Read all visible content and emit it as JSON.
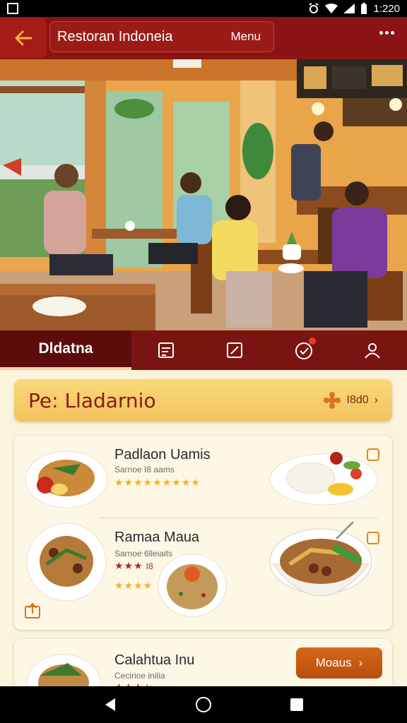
{
  "status_bar": {
    "time": "1:220"
  },
  "app_bar": {
    "title": "Restoran Indoneia",
    "menu_label": "Menu"
  },
  "tabs": {
    "active_label": "Dldatna"
  },
  "promo": {
    "title": "Pe: Lladarnio",
    "right_text": "I8d0"
  },
  "items": [
    {
      "name": "Padlaon Uamis",
      "subtitle": "Sarnoe I8 aams",
      "stars": "★★★★★★★★★"
    },
    {
      "name": "Ramaa Maua",
      "subtitle": "Sarnoe 6lleiaits",
      "stars_red": "★★★",
      "stars_red_suffix": "I8",
      "stars": "★★★★"
    },
    {
      "name": "Calahtua Inu",
      "subtitle": "Cecirioe inilia",
      "stars_red": "★★★",
      "stars_red_suffix": "Ia"
    }
  ],
  "cta": {
    "label": "Moaus"
  },
  "colors": {
    "primary": "#8a1414",
    "accent": "#f3c35e",
    "cta": "#c65a12",
    "background": "#fbf3dc"
  }
}
